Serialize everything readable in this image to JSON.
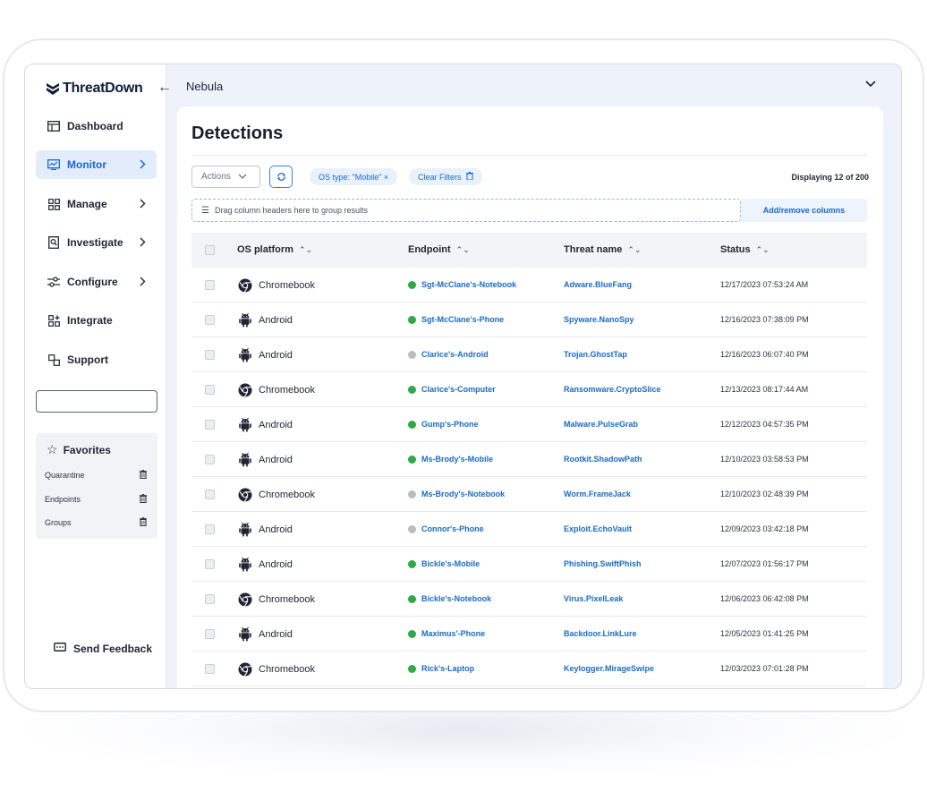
{
  "app": {
    "logo_text_bold": "ThreatDown",
    "workspace": "Nebula"
  },
  "sidebar": {
    "items": [
      {
        "label": "Dashboard",
        "icon": "dashboard-icon",
        "has_chevron": false,
        "active": false
      },
      {
        "label": "Monitor",
        "icon": "monitor-icon",
        "has_chevron": true,
        "active": true
      },
      {
        "label": "Manage",
        "icon": "manage-icon",
        "has_chevron": true,
        "active": false
      },
      {
        "label": "Investigate",
        "icon": "investigate-icon",
        "has_chevron": true,
        "active": false
      },
      {
        "label": "Configure",
        "icon": "configure-icon",
        "has_chevron": true,
        "active": false
      },
      {
        "label": "Integrate",
        "icon": "integrate-icon",
        "has_chevron": false,
        "active": false
      },
      {
        "label": "Support",
        "icon": "support-icon",
        "has_chevron": false,
        "active": false
      }
    ],
    "search_value": "",
    "favorites": {
      "title": "Favorites",
      "items": [
        "Quarantine",
        "Endpoints",
        "Groups"
      ]
    },
    "feedback_label": "Send Feedback"
  },
  "main": {
    "title": "Detections",
    "actions_label": "Actions",
    "filter_chip": "OS type: \"Mobile\" ×",
    "clear_filters": "Clear Filters",
    "displaying": "Displaying 12 of 200",
    "group_placeholder": "Drag column headers here to group results",
    "add_remove_columns": "Add/remove columns",
    "columns": [
      "OS platform",
      "Endpoint",
      "Threat name",
      "Status"
    ],
    "rows": [
      {
        "os": "Chromebook",
        "endpoint": "Sgt-McClane's-Notebook",
        "online": true,
        "threat": "Adware.BlueFang",
        "status": "12/17/2023 07:53:24 AM"
      },
      {
        "os": "Android",
        "endpoint": "Sgt-McClane's-Phone",
        "online": true,
        "threat": "Spyware.NanoSpy",
        "status": "12/16/2023 07:38:09 PM"
      },
      {
        "os": "Android",
        "endpoint": "Clarice's-Android",
        "online": false,
        "threat": "Trojan.GhostTap",
        "status": "12/16/2023 06:07:40 PM"
      },
      {
        "os": "Chromebook",
        "endpoint": "Clarice's-Computer",
        "online": true,
        "threat": "Ransomware.CryptoSlice",
        "status": "12/13/2023 08:17:44 AM"
      },
      {
        "os": "Android",
        "endpoint": "Gump's-Phone",
        "online": true,
        "threat": "Malware.PulseGrab",
        "status": "12/12/2023 04:57:35 PM"
      },
      {
        "os": "Android",
        "endpoint": "Ms-Brody's-Mobile",
        "online": true,
        "threat": "Rootkit.ShadowPath",
        "status": "12/10/2023 03:58:53 PM"
      },
      {
        "os": "Chromebook",
        "endpoint": "Ms-Brody's-Notebook",
        "online": false,
        "threat": "Worm.FrameJack",
        "status": "12/10/2023 02:48:39 PM"
      },
      {
        "os": "Android",
        "endpoint": "Connor's-Phone",
        "online": false,
        "threat": "Exploit.EchoVault",
        "status": "12/09/2023 03:42:18 PM"
      },
      {
        "os": "Android",
        "endpoint": "Bickle's-Mobile",
        "online": true,
        "threat": "Phishing.SwiftPhish",
        "status": "12/07/2023 01:56:17 PM"
      },
      {
        "os": "Chromebook",
        "endpoint": "Bickle's-Notebook",
        "online": true,
        "threat": "Virus.PixelLeak",
        "status": "12/06/2023 06:42:08 PM"
      },
      {
        "os": "Android",
        "endpoint": "Maximus'-Phone",
        "online": true,
        "threat": "Backdoor.LinkLure",
        "status": "12/05/2023 01:41:25 PM"
      },
      {
        "os": "Chromebook",
        "endpoint": "Rick's-Laptop",
        "online": true,
        "threat": "Keylogger.MirageSwipe",
        "status": "12/03/2023 07:01:28 PM"
      }
    ]
  },
  "colors": {
    "accent": "#1966d2",
    "link": "#1a6bc4",
    "online_dot": "#2eaa4a",
    "offline_dot": "#b9bcc4",
    "active_nav_bg": "#e2ecfb"
  }
}
